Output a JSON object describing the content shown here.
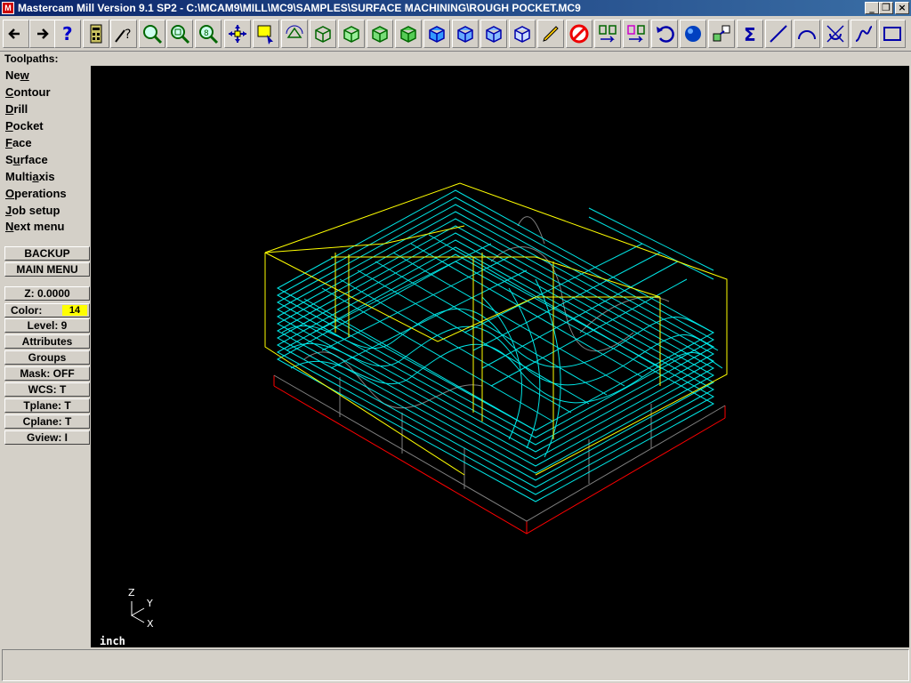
{
  "window": {
    "title": "Mastercam Mill Version 9.1 SP2 - C:\\MCAM9\\MILL\\MC9\\SAMPLES\\SURFACE MACHINING\\ROUGH POCKET.MC9",
    "controls": [
      "minimize-icon",
      "restore-icon",
      "close-icon"
    ]
  },
  "toolbar": {
    "buttons": [
      "back-arrow-icon",
      "forward-arrow-icon",
      "help-icon",
      "calculator-icon",
      "analyze-icon",
      "zoom-window-icon",
      "unzoom-icon",
      "zoom-fit-icon",
      "pan-icon",
      "screen-select-icon",
      "rotate-icon",
      "view-top-icon",
      "view-front-icon",
      "view-side-icon",
      "view-iso-icon",
      "shade-cube-1-icon",
      "shade-cube-2-icon",
      "shade-cube-3-icon",
      "shade-cube-4-icon",
      "pencil-icon",
      "no-delete-icon",
      "transform-icon",
      "transform-2-icon",
      "undo-icon",
      "sphere-icon",
      "layers-icon",
      "sum-icon",
      "line-icon",
      "arc-icon",
      "fillet-icon",
      "spline-icon",
      "rectangle-icon"
    ]
  },
  "menu": {
    "header": "Toolpaths:",
    "items": [
      {
        "pre": "Ne",
        "ul": "w",
        "post": ""
      },
      {
        "pre": "",
        "ul": "C",
        "post": "ontour"
      },
      {
        "pre": "",
        "ul": "D",
        "post": "rill"
      },
      {
        "pre": "",
        "ul": "P",
        "post": "ocket"
      },
      {
        "pre": "",
        "ul": "F",
        "post": "ace"
      },
      {
        "pre": "S",
        "ul": "u",
        "post": "rface"
      },
      {
        "pre": "Multi",
        "ul": "a",
        "post": "xis"
      },
      {
        "pre": "",
        "ul": "O",
        "post": "perations"
      },
      {
        "pre": "",
        "ul": "J",
        "post": "ob setup"
      },
      {
        "pre": "",
        "ul": "N",
        "post": "ext menu"
      }
    ]
  },
  "sidebar": {
    "backup": "BACKUP",
    "main_menu": "MAIN MENU",
    "z": "Z:  0.0000",
    "color_label": "Color:",
    "color_value": "14",
    "level": "Level:  9",
    "attributes": "Attributes",
    "groups": "Groups",
    "mask": "Mask:  OFF",
    "wcs": "WCS:   T",
    "tplane": "Tplane:  T",
    "cplane": "Cplane:  T",
    "gview": "Gview:   I"
  },
  "viewport": {
    "units": "inch",
    "axes": {
      "z": "Z",
      "y": "Y",
      "x": "X"
    },
    "colors": {
      "background": "#000000",
      "toolpath": "#00ffff",
      "boundary": "#ffff00",
      "stock": "#ff0000",
      "surfaces": "#808080"
    }
  },
  "colors": {
    "titlebar": "#0a246a",
    "panel": "#d4d0c8",
    "color_swatch": "#ffff00"
  }
}
